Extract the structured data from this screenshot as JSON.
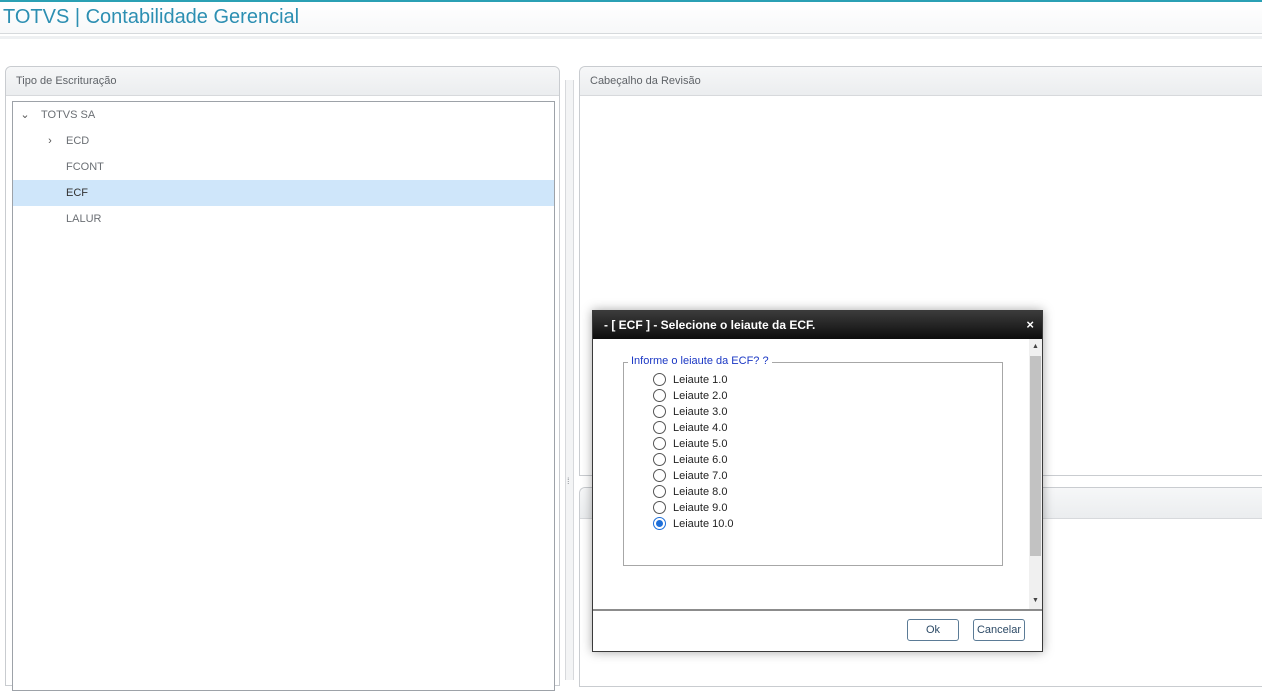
{
  "app": {
    "title": "TOTVS | Contabilidade Gerencial"
  },
  "left_panel": {
    "title": "Tipo de Escrituração",
    "tree": [
      {
        "label": "TOTVS SA",
        "level": 0,
        "arrow": "expanded",
        "selected": false
      },
      {
        "label": "ECD",
        "level": 1,
        "arrow": "collapsed",
        "selected": false
      },
      {
        "label": "FCONT",
        "level": 1,
        "arrow": "none",
        "selected": false
      },
      {
        "label": "ECF",
        "level": 1,
        "arrow": "none",
        "selected": true
      },
      {
        "label": "LALUR",
        "level": 1,
        "arrow": "none",
        "selected": false
      }
    ]
  },
  "right_panel": {
    "title": "Cabeçalho da Revisão"
  },
  "modal": {
    "title": "- [ ECF ] - Selecione o leiaute da ECF.",
    "close_label": "×",
    "fieldset_legend": "Informe o leiaute da ECF? ?",
    "options": [
      "Leiaute 1.0",
      "Leiaute 2.0",
      "Leiaute 3.0",
      "Leiaute 4.0",
      "Leiaute 5.0",
      "Leiaute 6.0",
      "Leiaute 7.0",
      "Leiaute 8.0",
      "Leiaute 9.0",
      "Leiaute 10.0"
    ],
    "selected_option": "Leiaute 10.0",
    "ok_label": "Ok",
    "cancel_label": "Cancelar"
  },
  "colors": {
    "title": "#2c8fb2",
    "selected_row": "#cfe6fa",
    "legend": "#1a37c4",
    "radio_checked": "#1e6fd9"
  }
}
